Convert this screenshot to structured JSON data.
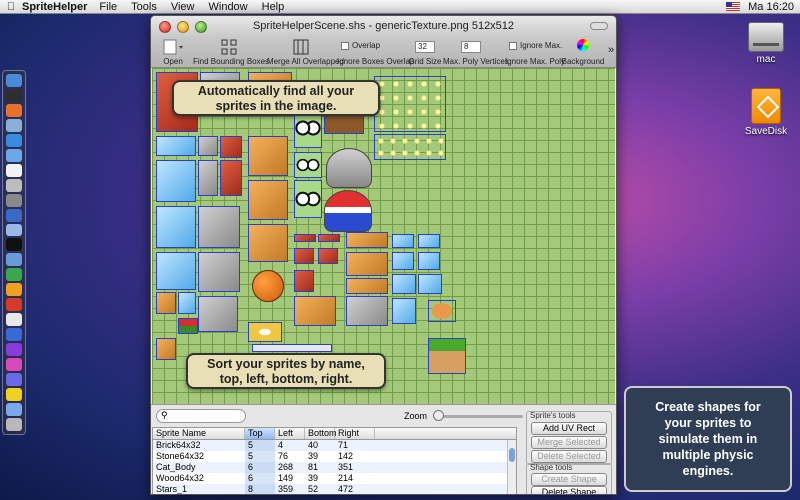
{
  "menubar": {
    "app_name": "SpriteHelper",
    "menus": [
      "File",
      "Tools",
      "View",
      "Window",
      "Help"
    ],
    "clock": "Ma 16:20"
  },
  "desktop": {
    "drive_label": "mac",
    "disk_label": "SaveDisk"
  },
  "window": {
    "title": "SpriteHelperScene.shs - genericTexture.png 512x512"
  },
  "toolbar": {
    "open": "Open",
    "find_bounding": "Find Bounding Boxes",
    "merge_all": "Merge All Overlapped",
    "overlap": "Overlap",
    "ignore_boxes": "Ignore Boxes Overlap",
    "grid_size_value": "32",
    "grid_size": "Grid Size",
    "max_poly_value": "8",
    "max_poly": "Max. Poly Vertices",
    "ignore_max": "Ignore Max.",
    "ignore_max_poly": "Ignore Max. Poly",
    "background": "Background"
  },
  "callouts": {
    "find_sprites": [
      "Automatically find all your",
      "sprites in the image."
    ],
    "sort_sprites": [
      "Sort your sprites by name,",
      "top, left, bottom, right."
    ],
    "create_shapes": [
      "Create shapes for",
      "your sprites to",
      "simulate them in",
      "multiple physic",
      "engines."
    ]
  },
  "bottom": {
    "zoom": "Zoom",
    "columns": [
      "Sprite Name",
      "Top",
      "Left",
      "Bottom",
      "Right"
    ],
    "rows": [
      [
        "Brick64x32",
        "5",
        "4",
        "40",
        "71"
      ],
      [
        "Stone64x32",
        "5",
        "76",
        "39",
        "142"
      ],
      [
        "Cat_Body",
        "6",
        "268",
        "81",
        "351"
      ],
      [
        "Wood64x32",
        "6",
        "149",
        "39",
        "214"
      ],
      [
        "Stars_1",
        "8",
        "359",
        "52",
        "472"
      ]
    ],
    "sprite_tools": "Sprite's tools",
    "add_uv": "Add UV Rect",
    "merge_selected": "Merge Selected",
    "delete_selected": "Delete Selected",
    "shape_tools": "Shape tools",
    "create_shape": "Create Shape",
    "delete_shape": "Delete Shape"
  },
  "colors": {
    "grid_bg": "#a4c97a",
    "bbox": "#2c3fc7",
    "callout_light": "#e9dfb7",
    "callout_dark": "#2f3d55"
  },
  "icons": [
    "apple-icon",
    "flag-icon",
    "hard-drive-icon",
    "save-disk-icon",
    "open-icon",
    "find-boxes-icon",
    "merge-icon",
    "color-wheel-icon",
    "search-icon"
  ]
}
